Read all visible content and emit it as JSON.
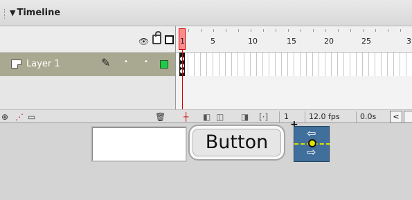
{
  "panel": {
    "title": "Timeline",
    "collapse_glyph": "▼"
  },
  "layer_header": {
    "icons": [
      "eye-icon",
      "lock-icon",
      "outline-icon"
    ]
  },
  "layers": [
    {
      "name": "Layer 1",
      "icon": "layer-icon",
      "edit_icon": "pencil-icon",
      "visibility": "•",
      "lock": "•",
      "outline_color": "#22c84c"
    }
  ],
  "layer_tools": {
    "icons": [
      "add-layer-icon",
      "add-motion-guide-icon",
      "add-folder-icon",
      "trash-icon"
    ]
  },
  "ruler": {
    "frame_numbers": [
      "1",
      "5",
      "10",
      "15",
      "20",
      "25",
      "3"
    ],
    "current_frame_marker": "1"
  },
  "status_bar": {
    "icons": [
      "center-frame-icon",
      "onion-skin-icon",
      "onion-outlines-icon",
      "edit-multiple-frames-icon",
      "modify-markers-icon"
    ],
    "current_frame": "1",
    "frame_rate": "12.0 fps",
    "elapsed_time": "0.0s",
    "scroll_left": "<"
  },
  "stage": {
    "button_label": "Button",
    "crosshair": "+",
    "component_icon": "ui-scrollbar-component-icon"
  },
  "colors": {
    "playhead": "#ff8a8a",
    "layer_row": "#a9a991",
    "component_bg": "#3f6f9a"
  }
}
